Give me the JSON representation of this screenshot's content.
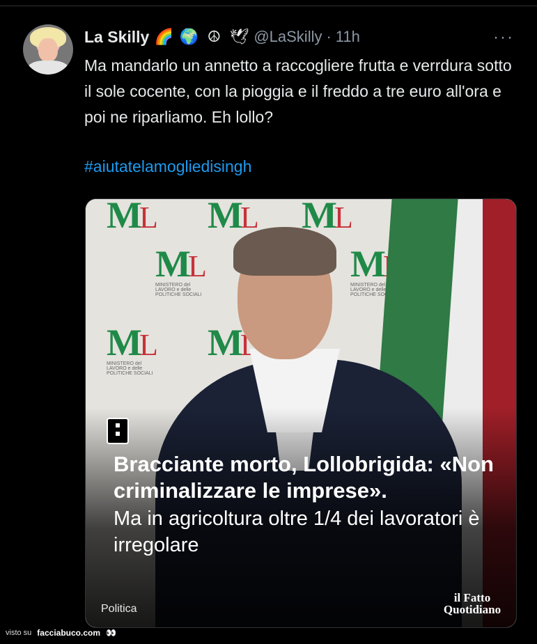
{
  "tweet": {
    "name": "La Skilly",
    "emojis": [
      "🌈",
      "🌍",
      "☮",
      "🕊"
    ],
    "handle": "@LaSkilly",
    "separator": "·",
    "time": "11h",
    "more": "···",
    "text": "Ma mandarlo un annetto a raccogliere frutta e verrdura sotto il sole cocente, con la pioggia e il freddo a tre euro all'ora e poi ne riparliamo. Eh lollo?",
    "hashtag": "#aiutatelamogliedisingh"
  },
  "card": {
    "headline": "Bracciante morto, Lollobrigida: «Non criminalizzare le imprese».",
    "subline": "Ma in agricoltura oltre 1/4 dei lavoratori è irregolare",
    "category": "Politica",
    "brand": "il Fatto Quotidiano",
    "logo_letter_m": "M",
    "logo_letter_l": "L",
    "logo_caption": "MINISTERO del LAVORO e delle POLITICHE SOCIALI"
  },
  "footer": {
    "visto": "visto su",
    "site": "facciabuco.com",
    "eyes": "👀"
  }
}
